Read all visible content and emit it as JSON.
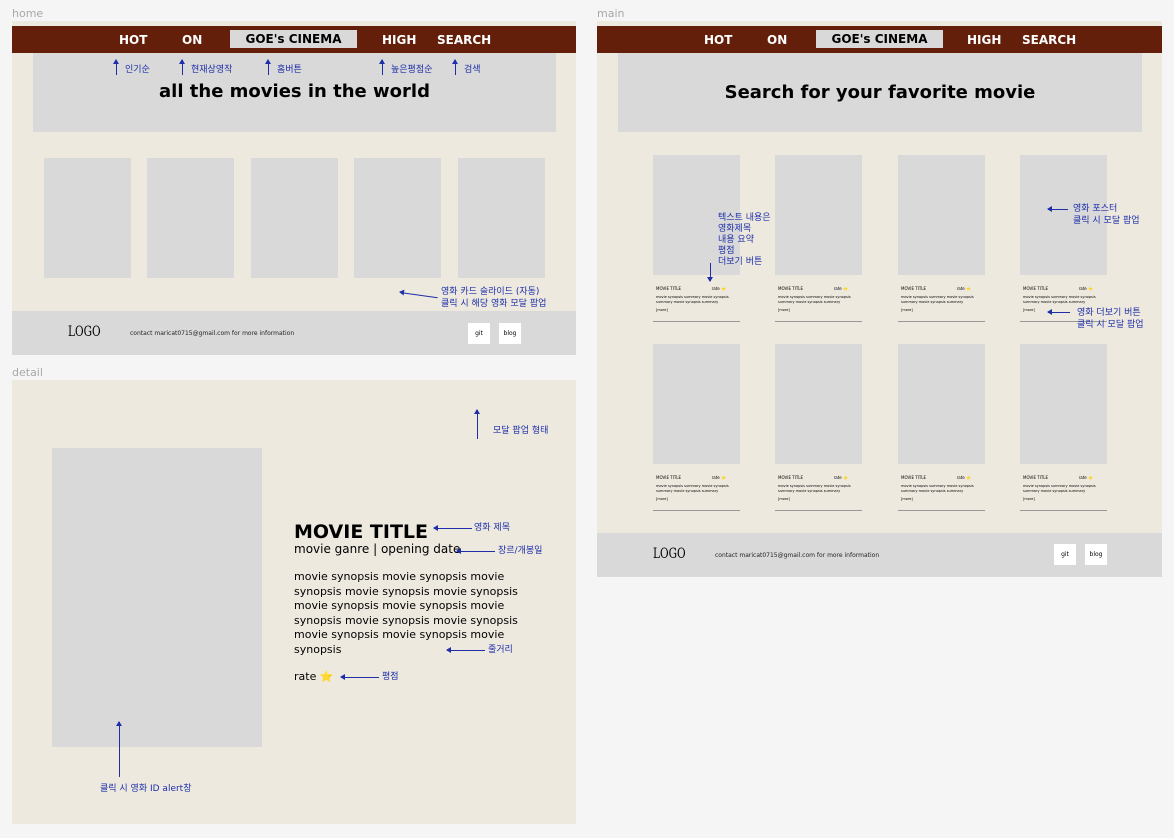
{
  "frames": {
    "home": "home",
    "main": "main",
    "detail": "detail"
  },
  "nav": {
    "hot": "HOT",
    "on": "ON",
    "brand": "GOE's CINEMA",
    "high": "HIGH",
    "search": "SEARCH"
  },
  "home": {
    "hero_title": "all the movies in the world",
    "annotations": {
      "popular": "인기순",
      "now_playing": "현재상영작",
      "home_button": "홈버튼",
      "high_rating": "높은평점순",
      "search": "검색",
      "slide_line1": "영화 카드 슬라이드 (자동)",
      "slide_line2": "클릭 시 해당 영화 모달 팝업"
    }
  },
  "main": {
    "hero_title": "Search for your favorite movie",
    "card": {
      "title": "MOVIE TITLE",
      "rate": "rate ⭐",
      "summary": "movie synopsis summary movie synopsis summary movie synopsis summary",
      "more": "[more]"
    },
    "annotations": {
      "text_content": [
        "텍스트 내용은",
        "영화제목",
        "내용 요약",
        "평점",
        "더보기 버튼"
      ],
      "poster_line1": "영화 포스터",
      "poster_line2": "클릭 시 모달 팝업",
      "more_line1": "영화 더보기 버튼",
      "more_line2": "클릭 시 모달 팝업"
    }
  },
  "footer": {
    "logo": "LOGO",
    "contact": "contact maricat0715@gmail.com for more information",
    "git": "git",
    "blog": "blog"
  },
  "detail": {
    "title": "MOVIE TITLE",
    "genre_date": "movie ganre | opening date",
    "synopsis": "movie synopsis movie synopsis movie synopsis movie synopsis movie synopsis movie synopsis movie synopsis movie synopsis movie synopsis movie synopsis movie synopsis movie synopsis movie synopsis",
    "rate": "rate ⭐",
    "annotations": {
      "modal": "모달 팝업 형태",
      "title": "영화 제목",
      "genre": "장르/개봉일",
      "plot": "줄거리",
      "rating": "평점",
      "poster_click": "클릭 시 영화 ID alert창"
    }
  }
}
